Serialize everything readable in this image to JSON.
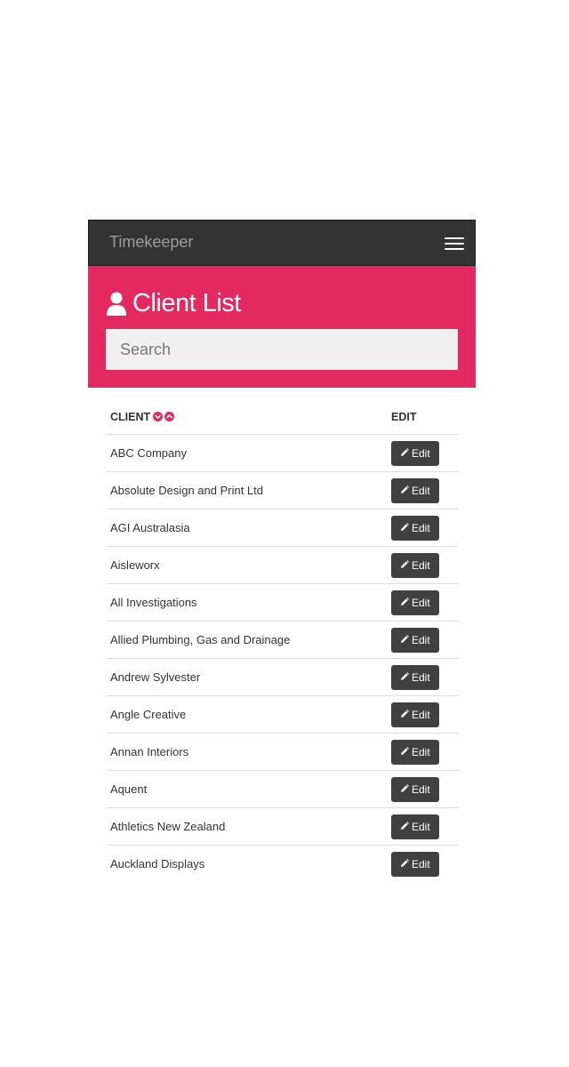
{
  "navbar": {
    "brand": "Timekeeper",
    "menu_icon": "hamburger-menu-icon"
  },
  "header": {
    "icon": "user-icon",
    "title": "Client List",
    "search_placeholder": "Search",
    "background_color": "#e32862"
  },
  "table": {
    "columns": {
      "client": "CLIENT",
      "edit": "EDIT"
    },
    "sort_icons": [
      "sort-descending-icon",
      "sort-ascending-icon"
    ],
    "edit_label": "Edit",
    "edit_icon": "pencil-icon",
    "rows": [
      {
        "client": "ABC Company"
      },
      {
        "client": "Absolute Design and Print Ltd"
      },
      {
        "client": "AGI Australasia"
      },
      {
        "client": "Aisleworx"
      },
      {
        "client": "All Investigations"
      },
      {
        "client": "Allied Plumbing, Gas and Drainage"
      },
      {
        "client": "Andrew Sylvester"
      },
      {
        "client": "Angle Creative"
      },
      {
        "client": "Annan Interiors"
      },
      {
        "client": "Aquent"
      },
      {
        "client": "Athletics New Zealand"
      },
      {
        "client": "Auckland Displays"
      }
    ]
  }
}
